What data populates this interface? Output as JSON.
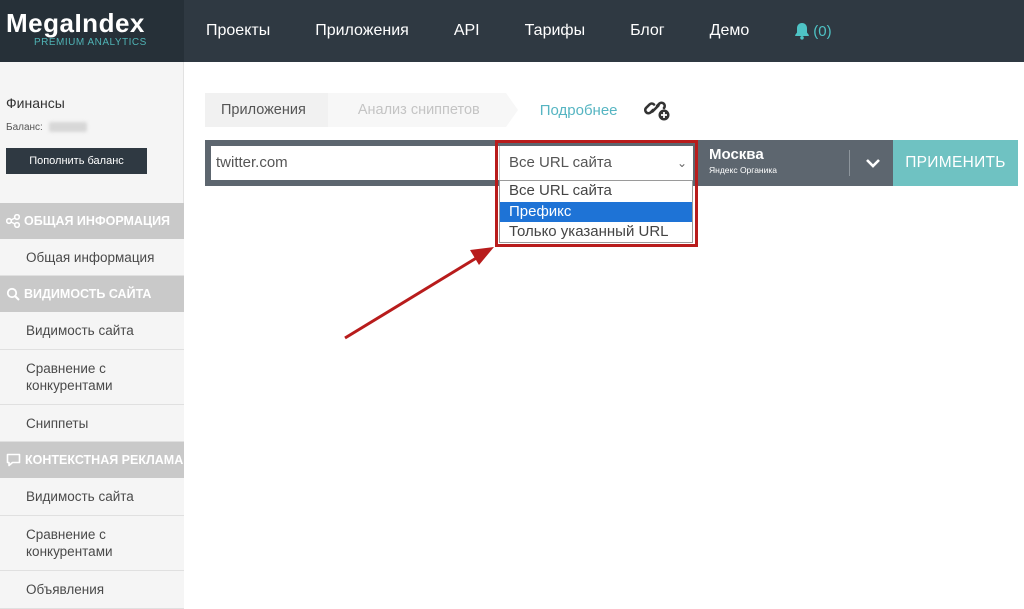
{
  "brand": {
    "name": "MegaIndex",
    "tagline": "PREMIUM ANALYTICS"
  },
  "nav": {
    "items": [
      "Проекты",
      "Приложения",
      "API",
      "Тарифы",
      "Блог",
      "Демо"
    ],
    "notifications": "(0)"
  },
  "sidebar": {
    "finance_title": "Финансы",
    "balance_label": "Баланс:",
    "topup_label": "Пополнить баланс",
    "sections": [
      {
        "label": "ОБЩАЯ ИНФОРМАЦИЯ",
        "icon": "share-icon",
        "items": [
          "Общая информация"
        ]
      },
      {
        "label": "ВИДИМОСТЬ САЙТА",
        "icon": "search-icon",
        "items": [
          "Видимость сайта",
          "Сравнение с конкурентами",
          "Сниппеты"
        ]
      },
      {
        "label": "КОНТЕКСТНАЯ РЕКЛАМА",
        "icon": "chat-icon",
        "items": [
          "Видимость сайта",
          "Сравнение с конкурентами",
          "Объявления"
        ]
      }
    ]
  },
  "breadcrumb": [
    "Приложения",
    "Анализ сниппетов"
  ],
  "more_link": "Подробнее",
  "filter": {
    "domain_value": "twitter.com",
    "url_scope_selected": "Все URL сайта",
    "url_scope_options": [
      "Все URL сайта",
      "Префикс",
      "Только указанный URL"
    ],
    "highlighted_option": "Префикс",
    "region_name": "Москва",
    "region_source": "Яндекс Органика",
    "apply_label": "ПРИМЕНИТЬ"
  },
  "colors": {
    "topbar": "#2f3942",
    "accent": "#6fc2c2",
    "highlight": "#b81c1c",
    "selected_option": "#1e73d6"
  }
}
